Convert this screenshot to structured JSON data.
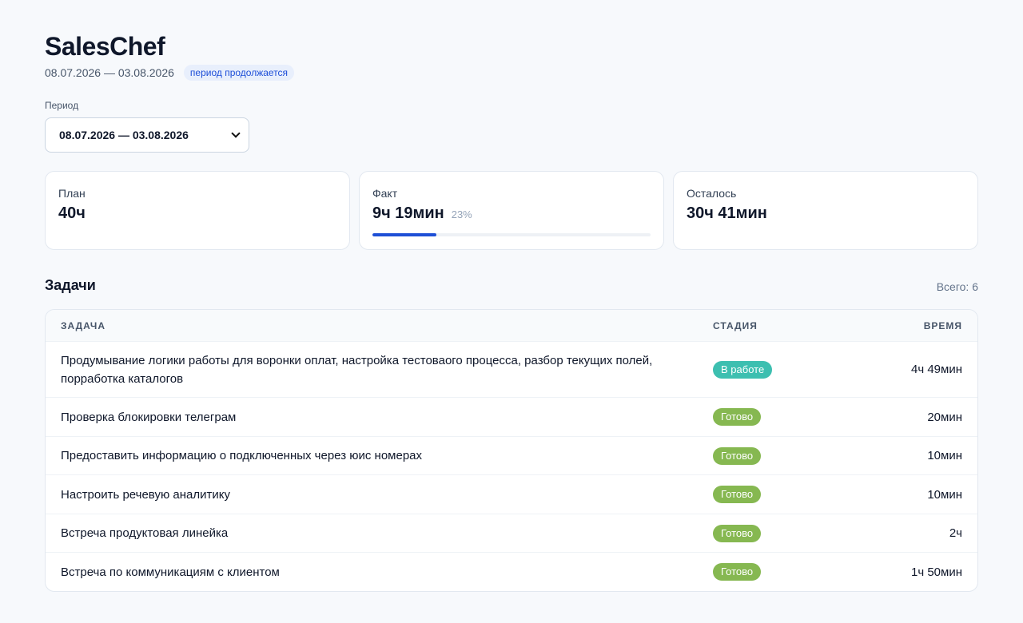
{
  "header": {
    "title": "SalesChef",
    "period_range": "08.07.2026 — 03.08.2026",
    "period_status": "период продолжается"
  },
  "period_selector": {
    "label": "Период",
    "selected": "08.07.2026 — 03.08.2026"
  },
  "cards": {
    "plan": {
      "label": "План",
      "value": "40ч"
    },
    "fact": {
      "label": "Факт",
      "value": "9ч 19мин",
      "percent_text": "23%",
      "progress": 0.23
    },
    "remaining": {
      "label": "Осталось",
      "value": "30ч 41мин"
    }
  },
  "tasks": {
    "title": "Задачи",
    "total": "Всего: 6",
    "columns": {
      "task": "ЗАДАЧА",
      "stage": "СТАДИЯ",
      "time": "ВРЕМЯ"
    },
    "rows": [
      {
        "task": "Продумывание логики работы для воронки оплат, настройка тестоваого процесса, разбор текущих полей, порработка каталогов",
        "stage": "В работе",
        "time": "4ч 49мин"
      },
      {
        "task": "Проверка блокировки телеграм",
        "stage": "Готово",
        "time": "20мин"
      },
      {
        "task": "Предоставить информацию о подключенных через юис номерах",
        "stage": "Готово",
        "time": "10мин"
      },
      {
        "task": "Настроить речевую аналитику",
        "stage": "Готово",
        "time": "10мин"
      },
      {
        "task": "Встреча продуктовая линейка",
        "stage": "Готово",
        "time": "2ч"
      },
      {
        "task": "Встреча по коммуникациям с клиентом",
        "stage": "Готово",
        "time": "1ч 50мин"
      }
    ]
  },
  "colors": {
    "accent": "#1e4fd6",
    "stage_in_progress": "#3dbfb0",
    "stage_done": "#86b851"
  },
  "icons": {
    "select_arrow": "chevron-down-icon"
  }
}
